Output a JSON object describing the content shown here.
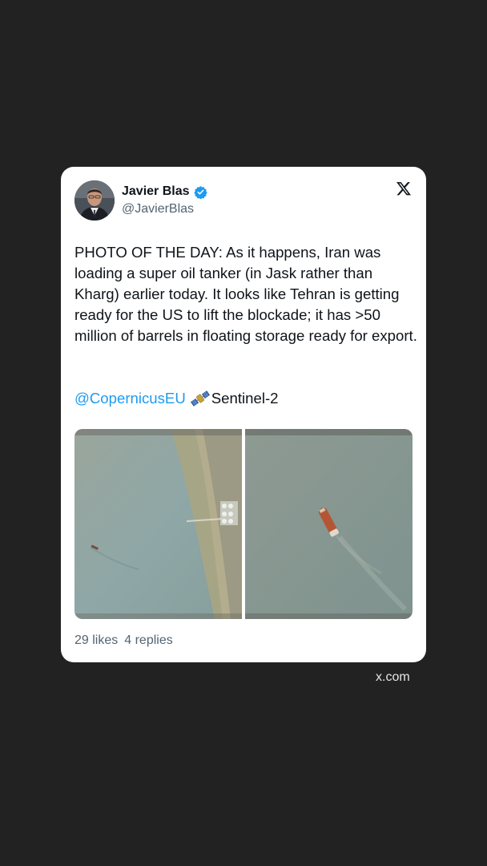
{
  "author": {
    "name": "Javier Blas",
    "handle": "@JavierBlas",
    "verified": true,
    "avatar_icon": "profile-photo"
  },
  "platform_icon": "x-logo-icon",
  "tweet": {
    "text": "PHOTO OF THE DAY: As it happens, Iran was loading a super oil tanker (in Jask rather than Kharg) earlier today. It looks like Tehran is getting ready for the US to lift the blockade; it has >50 million of barrels in floating storage ready for export.",
    "mention": "@CopernicusEU",
    "emoji": "satellite",
    "tag": "Sentinel-2"
  },
  "media": [
    {
      "kind": "satellite-image",
      "subject": "coastline with oil terminal and tanker"
    },
    {
      "kind": "satellite-image",
      "subject": "close-up of oil tanker with wake"
    }
  ],
  "stats": {
    "likes": "29 likes",
    "replies": "4 replies"
  },
  "source": "x.com",
  "colors": {
    "background": "#222222",
    "card": "#ffffff",
    "link": "#1d9bf0",
    "verified": "#1d9bf0",
    "secondary_text": "#536471"
  }
}
